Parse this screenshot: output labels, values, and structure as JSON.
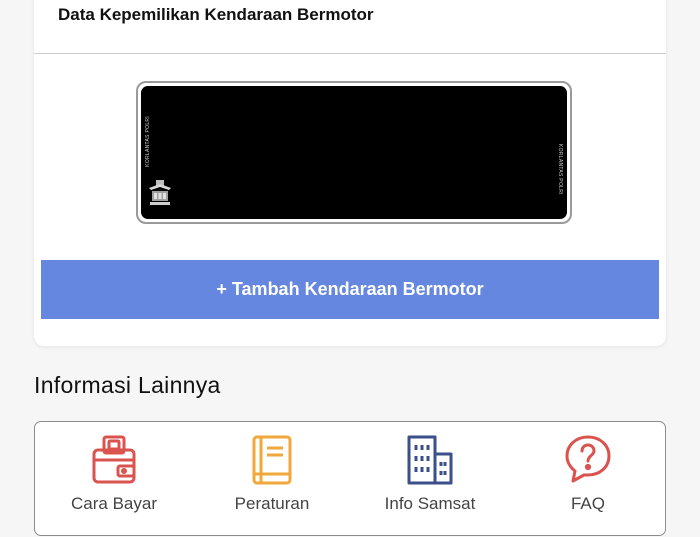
{
  "vehicle_card": {
    "title": "Data Kepemilikan Kendaraan Bermotor",
    "plate_left_text": "KORLANTAS POLRI",
    "plate_right_text": "KORLANTAS POLRI",
    "add_button_label": "+ Tambah Kendaraan Bermotor"
  },
  "info_section": {
    "title": "Informasi Lainnya",
    "items": [
      {
        "label": "Cara Bayar",
        "icon": "wallet-icon",
        "color": "#d9534f"
      },
      {
        "label": "Peraturan",
        "icon": "book-icon",
        "color": "#f0a83a"
      },
      {
        "label": "Info Samsat",
        "icon": "building-icon",
        "color": "#3b4f8a"
      },
      {
        "label": "FAQ",
        "icon": "question-bubble-icon",
        "color": "#d9534f"
      }
    ]
  },
  "colors": {
    "primary_button": "#6687e0",
    "background": "#f6f6f6"
  }
}
